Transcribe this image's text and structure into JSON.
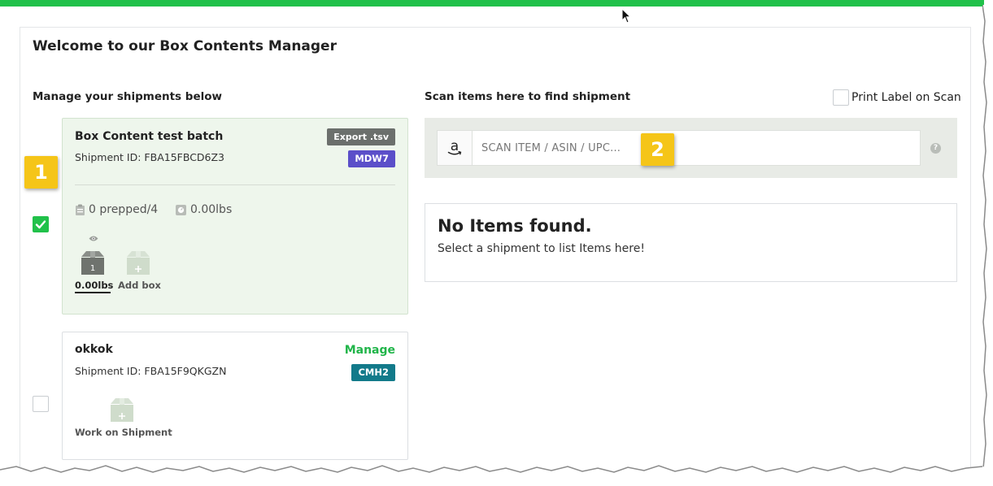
{
  "page": {
    "title": "Welcome to our Box Contents Manager",
    "left_heading": "Manage your shipments below",
    "right_heading": "Scan items here to find shipment"
  },
  "colors": {
    "top_bar": "#21c14a",
    "accent_green": "#21b54a",
    "badge_purple": "#5b4fc9",
    "badge_teal": "#127a8a",
    "callout_yellow": "#f5c518",
    "export_button": "#6b6f6c"
  },
  "shipments": [
    {
      "name": "Box Content test batch",
      "shipment_id": "Shipment ID: FBA15FBCD6Z3",
      "export_label": "Export .tsv",
      "badge": "MDW7",
      "selected": true,
      "prepped": "0 prepped/4",
      "weight": "0.00lbs",
      "boxes": [
        {
          "number": "1",
          "label": "0.00lbs",
          "icon": "box-icon"
        }
      ],
      "add_box_label": "Add box",
      "add_box_icon": "box-plus-icon",
      "preview_icon": "eye-icon"
    },
    {
      "name": "okkok",
      "shipment_id": "Shipment ID: FBA15F9QKGZN",
      "manage_label": "Manage",
      "badge": "CMH2",
      "selected": false,
      "work_label": "Work on Shipment",
      "work_icon": "box-plus-icon"
    }
  ],
  "scan": {
    "placeholder": "SCAN ITEM / ASIN / UPC...",
    "value": "",
    "source_icon": "amazon-icon",
    "help_icon": "question-icon",
    "help_glyph": "?"
  },
  "print_label": {
    "label": "Print Label on Scan",
    "checked": false
  },
  "empty_state": {
    "title": "No Items found.",
    "subtitle": "Select a shipment to list Items here!"
  },
  "callouts": [
    "1",
    "2"
  ]
}
